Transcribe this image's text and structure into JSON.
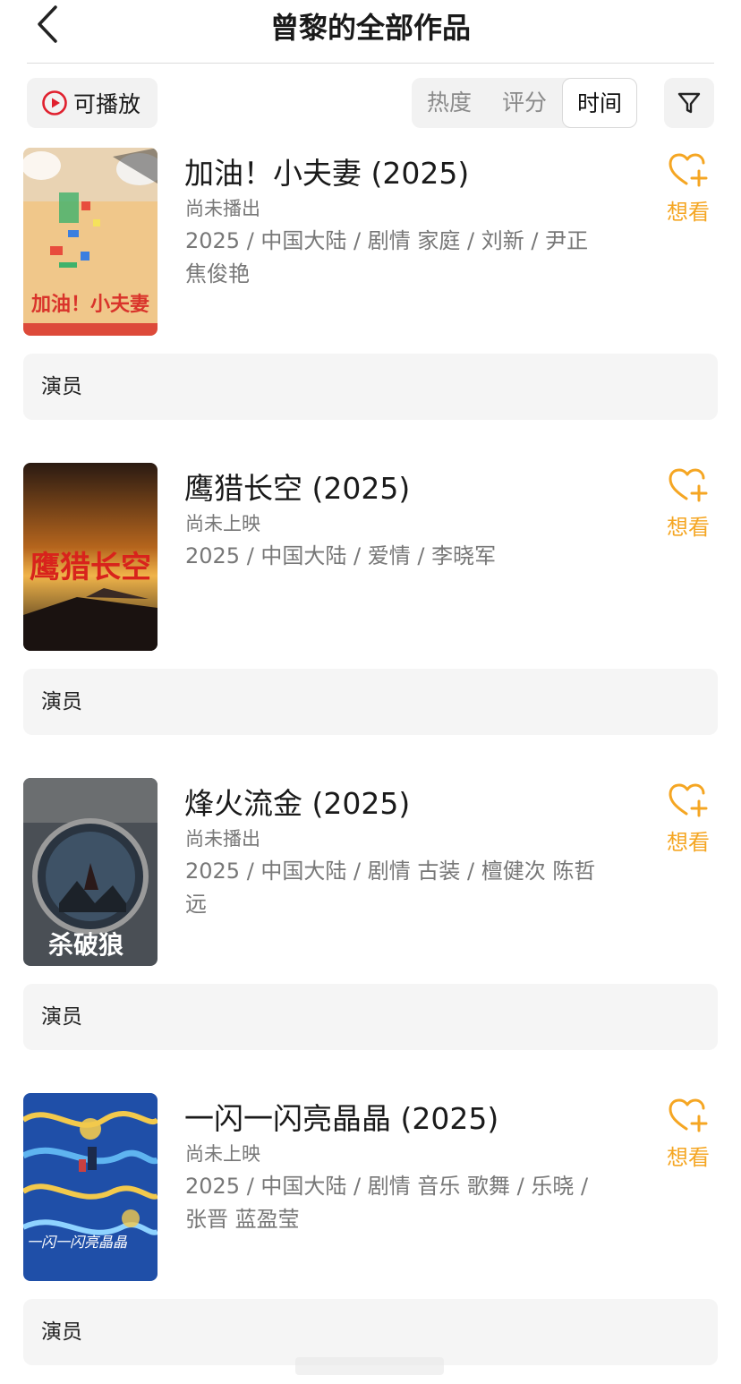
{
  "header": {
    "title": "曾黎的全部作品"
  },
  "filter_bar": {
    "playable_label": "可播放",
    "sort_tabs": [
      {
        "label": "热度",
        "active": false
      },
      {
        "label": "评分",
        "active": false
      },
      {
        "label": "时间",
        "active": true
      }
    ]
  },
  "colors": {
    "accent_orange": "#f5a623",
    "play_red": "#e0202e",
    "role_bar_bg": "#f5f5f5"
  },
  "works": [
    {
      "title": "加油！小夫妻 (2025)",
      "status": "尚未播出",
      "meta": "2025 / 中国大陆 / 剧情 家庭 / 刘新 / 尹正 焦俊艳",
      "want_label": "想看",
      "role": "演员",
      "poster_text": "加油！小夫妻"
    },
    {
      "title": "鹰猎长空 (2025)",
      "status": "尚未上映",
      "meta": "2025 / 中国大陆 / 爱情 / 李晓军",
      "want_label": "想看",
      "role": "演员",
      "poster_text": "鹰猎长空"
    },
    {
      "title": "烽火流金 (2025)",
      "status": "尚未播出",
      "meta": "2025 / 中国大陆 / 剧情 古装 / 檀健次 陈哲远",
      "want_label": "想看",
      "role": "演员",
      "poster_text": "杀破狼"
    },
    {
      "title": "一闪一闪亮晶晶 (2025)",
      "status": "尚未上映",
      "meta": "2025 / 中国大陆 / 剧情 音乐 歌舞 / 乐晓 / 张晋 蓝盈莹",
      "want_label": "想看",
      "role": "演员",
      "poster_text": "一闪一闪亮晶晶"
    }
  ]
}
